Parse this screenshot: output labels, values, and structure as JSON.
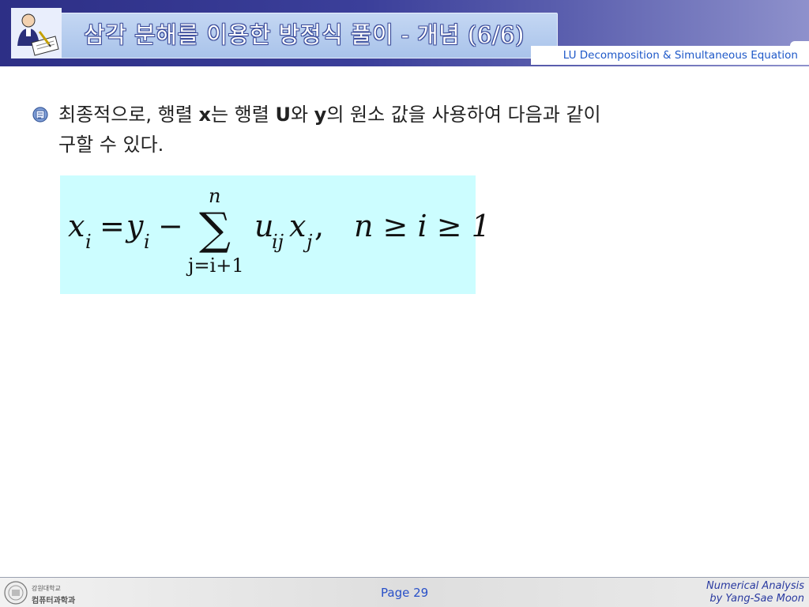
{
  "header": {
    "title": "삼각 분해를 이용한 방정식 풀이 - 개념 (6/6)",
    "subtitle": "LU Decomposition & Simultaneous Equation"
  },
  "body": {
    "para_part1": "최종적으로, 행렬 ",
    "var_x": "x",
    "para_part2": "는 행렬 ",
    "var_U": "U",
    "para_part3": "와 ",
    "var_y": "y",
    "para_part4": "의 원소 값을 사용하여 다음과 같이",
    "para_line2": "구할 수 있다."
  },
  "formula": {
    "lhs_x": "x",
    "lhs_sub": "i",
    "equals": "=",
    "y": "y",
    "y_sub": "i",
    "minus": "−",
    "sum_symbol": "∑",
    "sum_upper": "n",
    "sum_lower": "j=i+1",
    "u": "u",
    "u_sub": "ij",
    "x2": "x",
    "x2_sub": "j",
    "comma": ",",
    "condition": "n ≥ i ≥ 1"
  },
  "footer": {
    "logo_text_top": "강원대학교",
    "logo_text_bottom": "컴퓨터과학과",
    "page": "Page 29",
    "credit_line1": "Numerical Analysis",
    "credit_line2": "by Yang-Sae Moon"
  },
  "colors": {
    "header_dark": "#2d2f86",
    "title_panel": "#b3cbee",
    "subtitle": "#1e58c8",
    "formula_bg": "#ccfdff",
    "footer_text": "#2a3aa0"
  }
}
